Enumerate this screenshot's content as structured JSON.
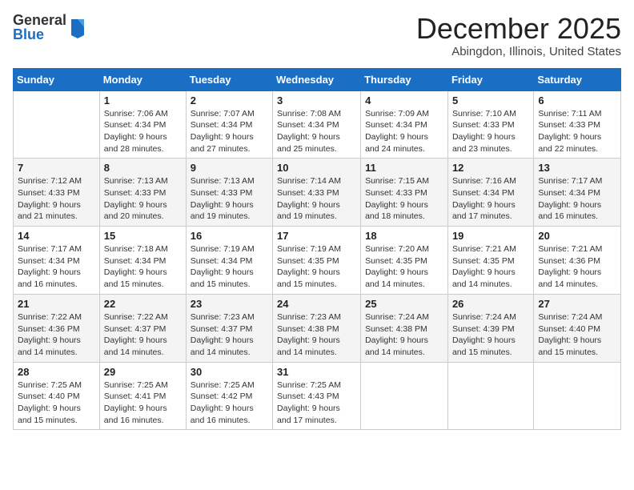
{
  "logo": {
    "general": "General",
    "blue": "Blue"
  },
  "title": "December 2025",
  "location": "Abingdon, Illinois, United States",
  "days_of_week": [
    "Sunday",
    "Monday",
    "Tuesday",
    "Wednesday",
    "Thursday",
    "Friday",
    "Saturday"
  ],
  "weeks": [
    [
      {
        "day": "",
        "sunrise": "",
        "sunset": "",
        "daylight": ""
      },
      {
        "day": "1",
        "sunrise": "Sunrise: 7:06 AM",
        "sunset": "Sunset: 4:34 PM",
        "daylight": "Daylight: 9 hours and 28 minutes."
      },
      {
        "day": "2",
        "sunrise": "Sunrise: 7:07 AM",
        "sunset": "Sunset: 4:34 PM",
        "daylight": "Daylight: 9 hours and 27 minutes."
      },
      {
        "day": "3",
        "sunrise": "Sunrise: 7:08 AM",
        "sunset": "Sunset: 4:34 PM",
        "daylight": "Daylight: 9 hours and 25 minutes."
      },
      {
        "day": "4",
        "sunrise": "Sunrise: 7:09 AM",
        "sunset": "Sunset: 4:34 PM",
        "daylight": "Daylight: 9 hours and 24 minutes."
      },
      {
        "day": "5",
        "sunrise": "Sunrise: 7:10 AM",
        "sunset": "Sunset: 4:33 PM",
        "daylight": "Daylight: 9 hours and 23 minutes."
      },
      {
        "day": "6",
        "sunrise": "Sunrise: 7:11 AM",
        "sunset": "Sunset: 4:33 PM",
        "daylight": "Daylight: 9 hours and 22 minutes."
      }
    ],
    [
      {
        "day": "7",
        "sunrise": "Sunrise: 7:12 AM",
        "sunset": "Sunset: 4:33 PM",
        "daylight": "Daylight: 9 hours and 21 minutes."
      },
      {
        "day": "8",
        "sunrise": "Sunrise: 7:13 AM",
        "sunset": "Sunset: 4:33 PM",
        "daylight": "Daylight: 9 hours and 20 minutes."
      },
      {
        "day": "9",
        "sunrise": "Sunrise: 7:13 AM",
        "sunset": "Sunset: 4:33 PM",
        "daylight": "Daylight: 9 hours and 19 minutes."
      },
      {
        "day": "10",
        "sunrise": "Sunrise: 7:14 AM",
        "sunset": "Sunset: 4:33 PM",
        "daylight": "Daylight: 9 hours and 19 minutes."
      },
      {
        "day": "11",
        "sunrise": "Sunrise: 7:15 AM",
        "sunset": "Sunset: 4:33 PM",
        "daylight": "Daylight: 9 hours and 18 minutes."
      },
      {
        "day": "12",
        "sunrise": "Sunrise: 7:16 AM",
        "sunset": "Sunset: 4:34 PM",
        "daylight": "Daylight: 9 hours and 17 minutes."
      },
      {
        "day": "13",
        "sunrise": "Sunrise: 7:17 AM",
        "sunset": "Sunset: 4:34 PM",
        "daylight": "Daylight: 9 hours and 16 minutes."
      }
    ],
    [
      {
        "day": "14",
        "sunrise": "Sunrise: 7:17 AM",
        "sunset": "Sunset: 4:34 PM",
        "daylight": "Daylight: 9 hours and 16 minutes."
      },
      {
        "day": "15",
        "sunrise": "Sunrise: 7:18 AM",
        "sunset": "Sunset: 4:34 PM",
        "daylight": "Daylight: 9 hours and 15 minutes."
      },
      {
        "day": "16",
        "sunrise": "Sunrise: 7:19 AM",
        "sunset": "Sunset: 4:34 PM",
        "daylight": "Daylight: 9 hours and 15 minutes."
      },
      {
        "day": "17",
        "sunrise": "Sunrise: 7:19 AM",
        "sunset": "Sunset: 4:35 PM",
        "daylight": "Daylight: 9 hours and 15 minutes."
      },
      {
        "day": "18",
        "sunrise": "Sunrise: 7:20 AM",
        "sunset": "Sunset: 4:35 PM",
        "daylight": "Daylight: 9 hours and 14 minutes."
      },
      {
        "day": "19",
        "sunrise": "Sunrise: 7:21 AM",
        "sunset": "Sunset: 4:35 PM",
        "daylight": "Daylight: 9 hours and 14 minutes."
      },
      {
        "day": "20",
        "sunrise": "Sunrise: 7:21 AM",
        "sunset": "Sunset: 4:36 PM",
        "daylight": "Daylight: 9 hours and 14 minutes."
      }
    ],
    [
      {
        "day": "21",
        "sunrise": "Sunrise: 7:22 AM",
        "sunset": "Sunset: 4:36 PM",
        "daylight": "Daylight: 9 hours and 14 minutes."
      },
      {
        "day": "22",
        "sunrise": "Sunrise: 7:22 AM",
        "sunset": "Sunset: 4:37 PM",
        "daylight": "Daylight: 9 hours and 14 minutes."
      },
      {
        "day": "23",
        "sunrise": "Sunrise: 7:23 AM",
        "sunset": "Sunset: 4:37 PM",
        "daylight": "Daylight: 9 hours and 14 minutes."
      },
      {
        "day": "24",
        "sunrise": "Sunrise: 7:23 AM",
        "sunset": "Sunset: 4:38 PM",
        "daylight": "Daylight: 9 hours and 14 minutes."
      },
      {
        "day": "25",
        "sunrise": "Sunrise: 7:24 AM",
        "sunset": "Sunset: 4:38 PM",
        "daylight": "Daylight: 9 hours and 14 minutes."
      },
      {
        "day": "26",
        "sunrise": "Sunrise: 7:24 AM",
        "sunset": "Sunset: 4:39 PM",
        "daylight": "Daylight: 9 hours and 15 minutes."
      },
      {
        "day": "27",
        "sunrise": "Sunrise: 7:24 AM",
        "sunset": "Sunset: 4:40 PM",
        "daylight": "Daylight: 9 hours and 15 minutes."
      }
    ],
    [
      {
        "day": "28",
        "sunrise": "Sunrise: 7:25 AM",
        "sunset": "Sunset: 4:40 PM",
        "daylight": "Daylight: 9 hours and 15 minutes."
      },
      {
        "day": "29",
        "sunrise": "Sunrise: 7:25 AM",
        "sunset": "Sunset: 4:41 PM",
        "daylight": "Daylight: 9 hours and 16 minutes."
      },
      {
        "day": "30",
        "sunrise": "Sunrise: 7:25 AM",
        "sunset": "Sunset: 4:42 PM",
        "daylight": "Daylight: 9 hours and 16 minutes."
      },
      {
        "day": "31",
        "sunrise": "Sunrise: 7:25 AM",
        "sunset": "Sunset: 4:43 PM",
        "daylight": "Daylight: 9 hours and 17 minutes."
      },
      {
        "day": "",
        "sunrise": "",
        "sunset": "",
        "daylight": ""
      },
      {
        "day": "",
        "sunrise": "",
        "sunset": "",
        "daylight": ""
      },
      {
        "day": "",
        "sunrise": "",
        "sunset": "",
        "daylight": ""
      }
    ]
  ]
}
